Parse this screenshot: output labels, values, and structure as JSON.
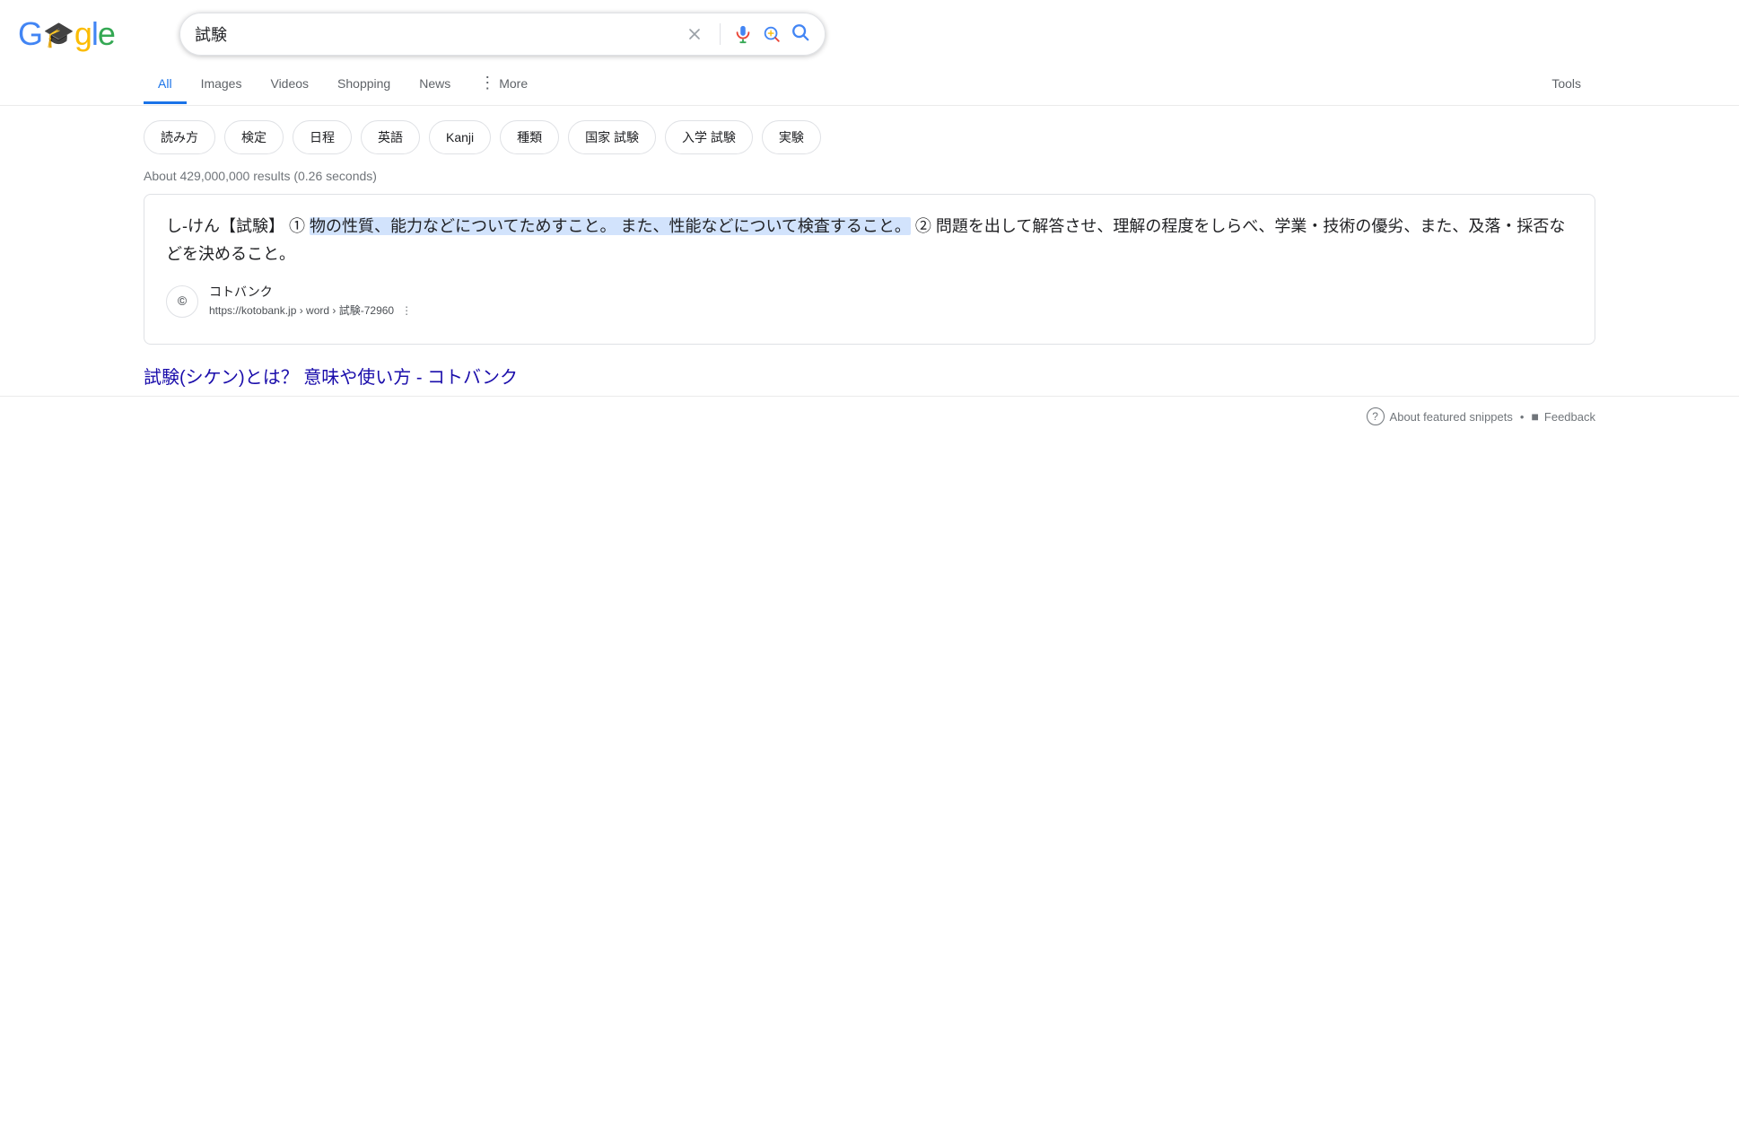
{
  "header": {
    "logo": "Google",
    "logo_letters": [
      "G",
      "o",
      "o",
      "g",
      "l",
      "e"
    ],
    "search_query": "試験",
    "clear_button_label": "×"
  },
  "nav": {
    "tabs": [
      {
        "id": "all",
        "label": "All",
        "active": true
      },
      {
        "id": "images",
        "label": "Images",
        "active": false
      },
      {
        "id": "videos",
        "label": "Videos",
        "active": false
      },
      {
        "id": "shopping",
        "label": "Shopping",
        "active": false
      },
      {
        "id": "news",
        "label": "News",
        "active": false
      },
      {
        "id": "more",
        "label": "More",
        "active": false
      },
      {
        "id": "tools",
        "label": "Tools",
        "active": false
      }
    ]
  },
  "chips": [
    {
      "label": "読み方"
    },
    {
      "label": "検定"
    },
    {
      "label": "日程"
    },
    {
      "label": "英語"
    },
    {
      "label": "Kanji"
    },
    {
      "label": "種類"
    },
    {
      "label": "国家 試験"
    },
    {
      "label": "入学 試験"
    },
    {
      "label": "実験"
    }
  ],
  "results_meta": "About 429,000,000 results (0.26 seconds)",
  "featured_snippet": {
    "text_parts": [
      {
        "text": "し‐けん【試験】 ① ",
        "highlighted": false
      },
      {
        "text": "物の性質、能力などについてためすこと。 また、性能などについて検査すること。",
        "highlighted": true
      },
      {
        "text": " ② 問題を出して解答させ、理解の程度をしらべ、学業・技術の優劣、また、及落・採否などを決めること。",
        "highlighted": false
      }
    ]
  },
  "result": {
    "source_favicon": "©",
    "source_name": "コトバンク",
    "source_url": "https://kotobank.jp › word › 試験-72960",
    "link_text": "試験(シケン)とは？ 意味や使い方 - コトバンク"
  },
  "bottom": {
    "about_snippets": "About featured snippets",
    "dot": "•",
    "feedback": "Feedback"
  },
  "icons": {
    "clear": "×",
    "mic": "mic-icon",
    "lens": "lens-icon",
    "search": "search-icon",
    "more_dots": "⋮",
    "chevron_down": "▾",
    "help": "?",
    "feedback": "■"
  }
}
